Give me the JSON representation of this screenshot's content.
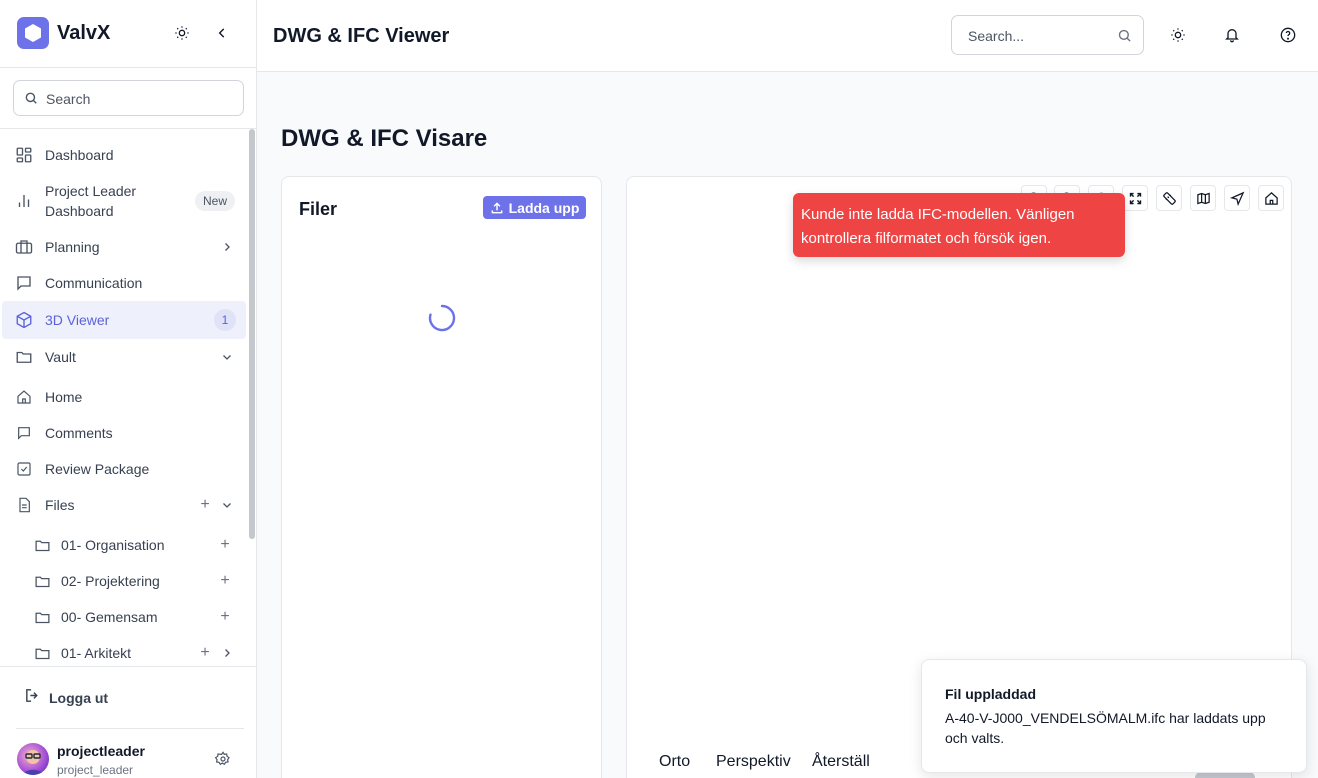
{
  "app": {
    "name": "ValvX"
  },
  "sidebar": {
    "search_placeholder": "Search",
    "items": [
      {
        "label": "Dashboard"
      },
      {
        "label_line1": "Project Leader",
        "label_line2": "Dashboard",
        "badge": "New"
      },
      {
        "label": "Planning"
      },
      {
        "label": "Communication"
      },
      {
        "label": "3D Viewer",
        "badge": "1"
      },
      {
        "label": "Vault"
      },
      {
        "label": "Home"
      },
      {
        "label": "Comments"
      },
      {
        "label": "Review Package"
      },
      {
        "label": "Files"
      },
      {
        "label": "01- Organisation"
      },
      {
        "label": "02- Projektering"
      },
      {
        "label": "00- Gemensam"
      },
      {
        "label": "01- Arkitekt"
      }
    ],
    "logout_label": "Logga ut",
    "user": {
      "name": "projectleader",
      "handle": "project_leader"
    }
  },
  "topbar": {
    "title": "DWG & IFC Viewer",
    "search_placeholder": "Search..."
  },
  "main": {
    "title": "DWG & IFC Visare",
    "files_panel": {
      "title": "Filer",
      "upload_label": "Ladda upp"
    },
    "viewer": {
      "error_message": "Kunde inte ladda IFC-modellen. Vänligen kontrollera filformatet och försök igen.",
      "view_buttons": [
        "Orto",
        "Perspektiv",
        "Återställ"
      ]
    }
  },
  "toast": {
    "title": "Fil uppladdad",
    "message": "A-40-V-J000_VENDELSÖMALM.ifc har laddats upp och valts."
  },
  "colors": {
    "accent": "#6d72e8",
    "error": "#ef4444",
    "active_bg": "#eef0fb"
  }
}
